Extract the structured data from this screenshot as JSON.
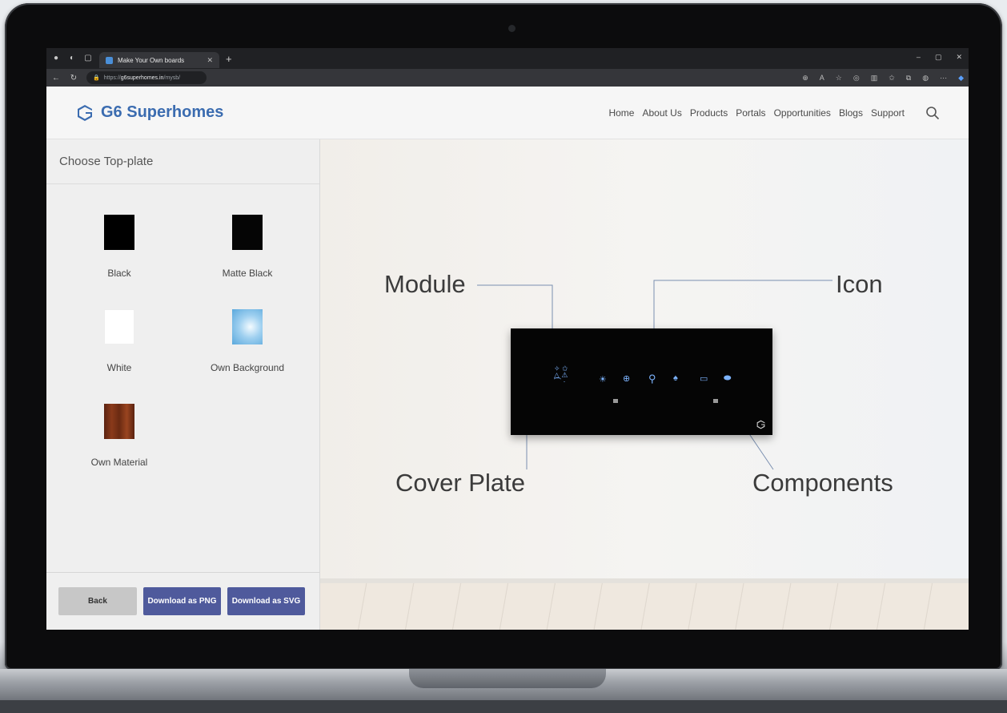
{
  "browser": {
    "tab_title": "Make Your Own boards",
    "url_prefix": "https://",
    "url_domain": "g6superhomes.in",
    "url_path": "/mysb/",
    "new_tab": "+",
    "window_controls": [
      "–",
      "▢",
      "✕"
    ]
  },
  "site": {
    "logo_text": "G6 Superhomes",
    "brand_color": "#3b6cb0",
    "nav": [
      "Home",
      "About Us",
      "Products",
      "Portals",
      "Opportunities",
      "Blogs",
      "Support"
    ]
  },
  "sidebar": {
    "title": "Choose Top-plate",
    "swatches": [
      {
        "label": "Black",
        "color": "#000000"
      },
      {
        "label": "Matte Black",
        "color": "#050505"
      },
      {
        "label": "White",
        "color": "#ffffff"
      },
      {
        "label": "Own Background",
        "color": "#9fd0f0"
      },
      {
        "label": "Own Material",
        "color": "#6a2a12"
      }
    ],
    "buttons": {
      "back": "Back",
      "download_png": "Download as PNG",
      "download_svg": "Download as SVG"
    }
  },
  "preview": {
    "labels": {
      "module": "Module",
      "icon": "Icon",
      "cover_plate": "Cover Plate",
      "components": "Components"
    },
    "accent_icon_color": "#7db4ff"
  }
}
